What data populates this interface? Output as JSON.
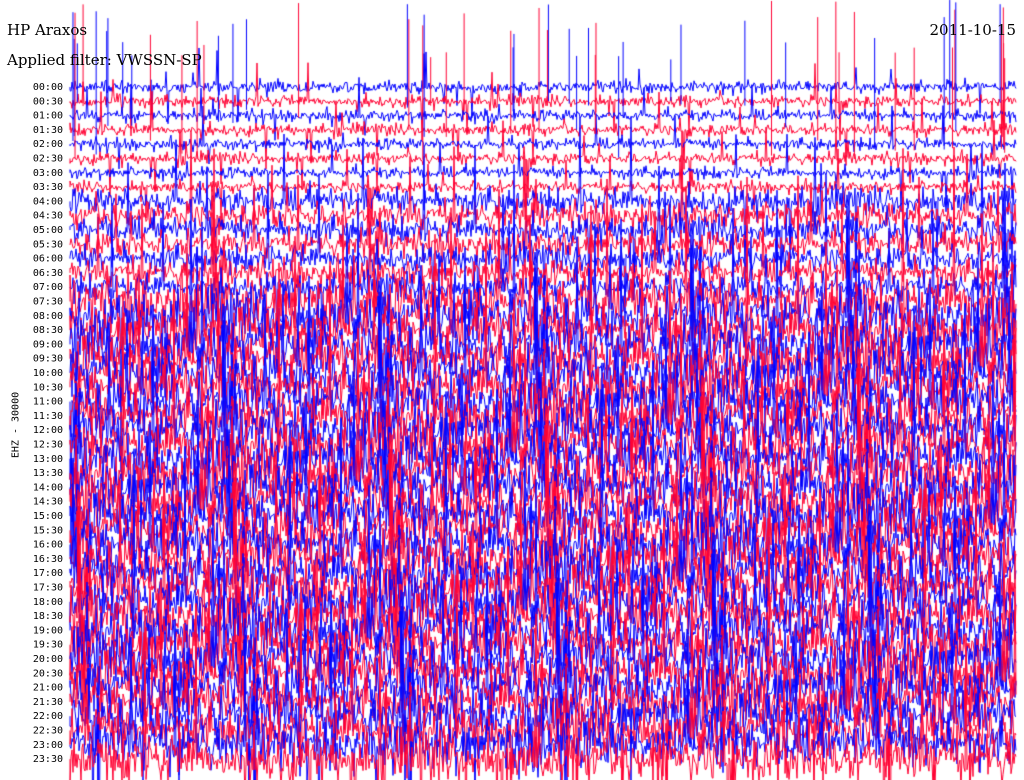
{
  "header": {
    "station": "HP Araxos",
    "filter": "Applied filter: VWSSN-SP",
    "date": "2011-10-15"
  },
  "chart_data": {
    "type": "line",
    "title": "HP Araxos",
    "date": "2011-10-15",
    "ylabel": "EHZ - 30000",
    "row_labels": [
      "00:00",
      "00:30",
      "01:00",
      "01:30",
      "02:00",
      "02:30",
      "03:00",
      "03:30",
      "04:00",
      "04:30",
      "05:00",
      "05:30",
      "06:00",
      "06:30",
      "07:00",
      "07:30",
      "08:00",
      "08:30",
      "09:00",
      "09:30",
      "10:00",
      "10:30",
      "11:00",
      "11:30",
      "12:00",
      "12:30",
      "13:00",
      "13:30",
      "14:00",
      "14:30",
      "15:00",
      "15:30",
      "16:00",
      "16:30",
      "17:00",
      "17:30",
      "18:00",
      "18:30",
      "19:00",
      "19:30",
      "20:00",
      "20:30",
      "21:00",
      "21:30",
      "22:00",
      "22:30",
      "23:00",
      "23:30"
    ],
    "trace_colors": [
      "#0000ff",
      "#ff0033"
    ],
    "grid": false,
    "legend": "none"
  }
}
